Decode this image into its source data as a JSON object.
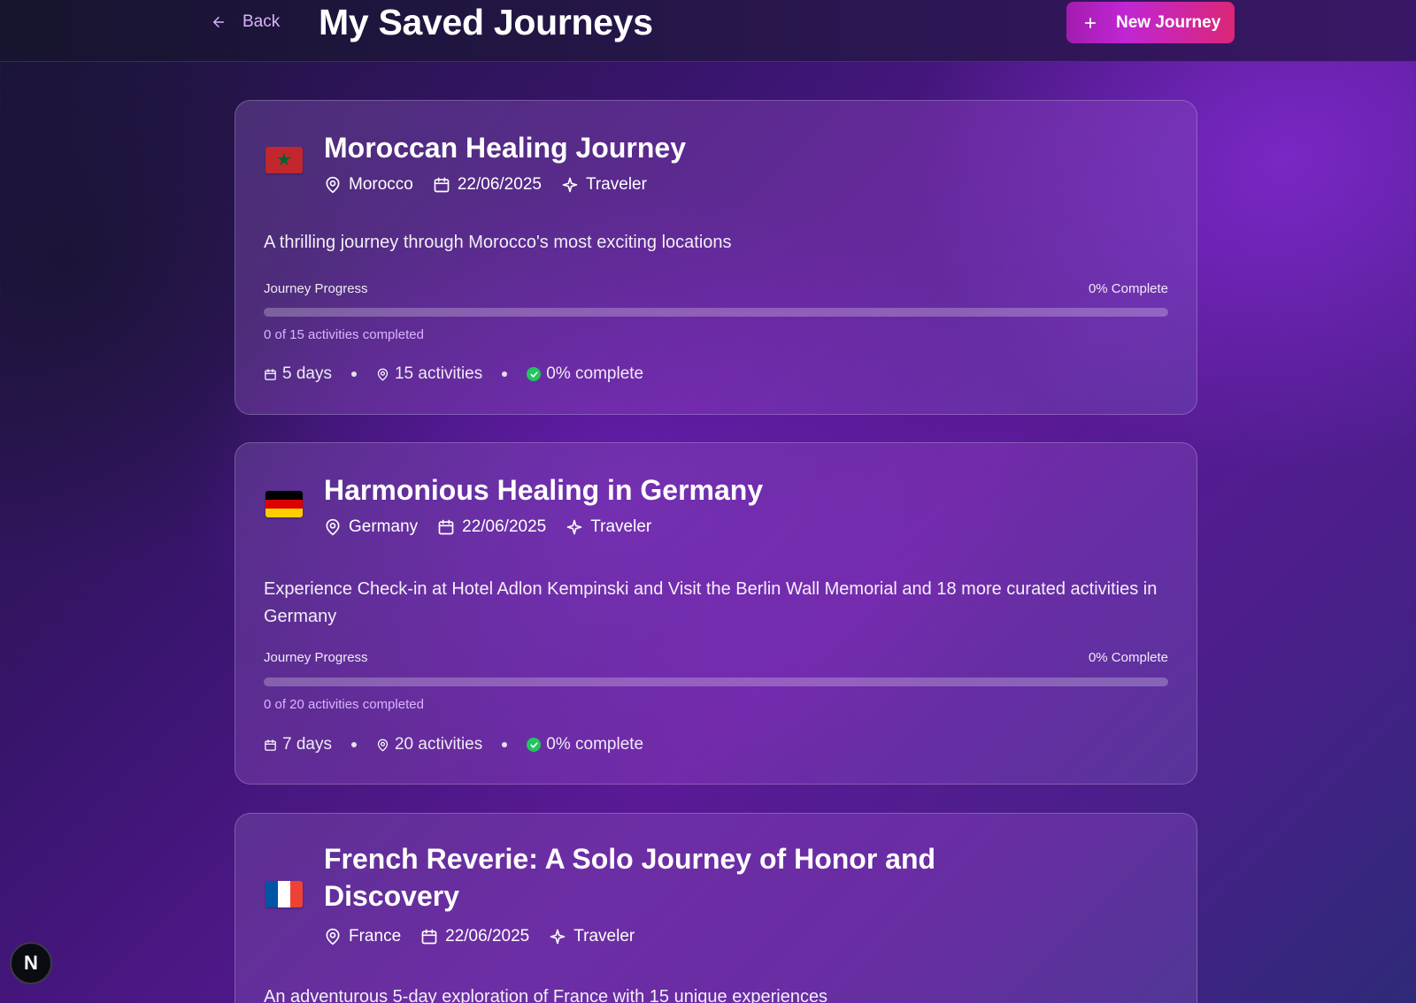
{
  "header": {
    "back_label": "Back",
    "title": "My Saved Journeys",
    "new_journey_label": "New Journey"
  },
  "journeys": [
    {
      "flag": "morocco-flag",
      "title": "Moroccan Healing Journey",
      "country": "Morocco",
      "date": "22/06/2025",
      "traveler_type": "Traveler",
      "description": "A thrilling journey through Morocco's most exciting locations",
      "progress_label": "Journey Progress",
      "progress_pct_label": "0% Complete",
      "progress_fraction": 0,
      "activities_completed": "0 of 15 activities completed",
      "days": "5 days",
      "activities": "15 activities",
      "complete": "0% complete"
    },
    {
      "flag": "germany-flag",
      "title": "Harmonious Healing in Germany",
      "country": "Germany",
      "date": "22/06/2025",
      "traveler_type": "Traveler",
      "description": "Experience Check-in at Hotel Adlon Kempinski and Visit the Berlin Wall Memorial and 18 more curated activities in Germany",
      "progress_label": "Journey Progress",
      "progress_pct_label": "0% Complete",
      "progress_fraction": 0,
      "activities_completed": "0 of 20 activities completed",
      "days": "7 days",
      "activities": "20 activities",
      "complete": "0% complete"
    },
    {
      "flag": "france-flag",
      "title": "French Reverie: A Solo Journey of Honor and Discovery",
      "country": "France",
      "date": "22/06/2025",
      "traveler_type": "Traveler",
      "description": "An adventurous 5-day exploration of France with 15 unique experiences"
    }
  ],
  "dev_badge": "N",
  "colors": {
    "accent_gradient_start": "#a21caf",
    "accent_gradient_end": "#db2777",
    "progress_track": "#ffffff40",
    "check_green": "#22c55e",
    "sub_text": "#d8b4fe"
  }
}
